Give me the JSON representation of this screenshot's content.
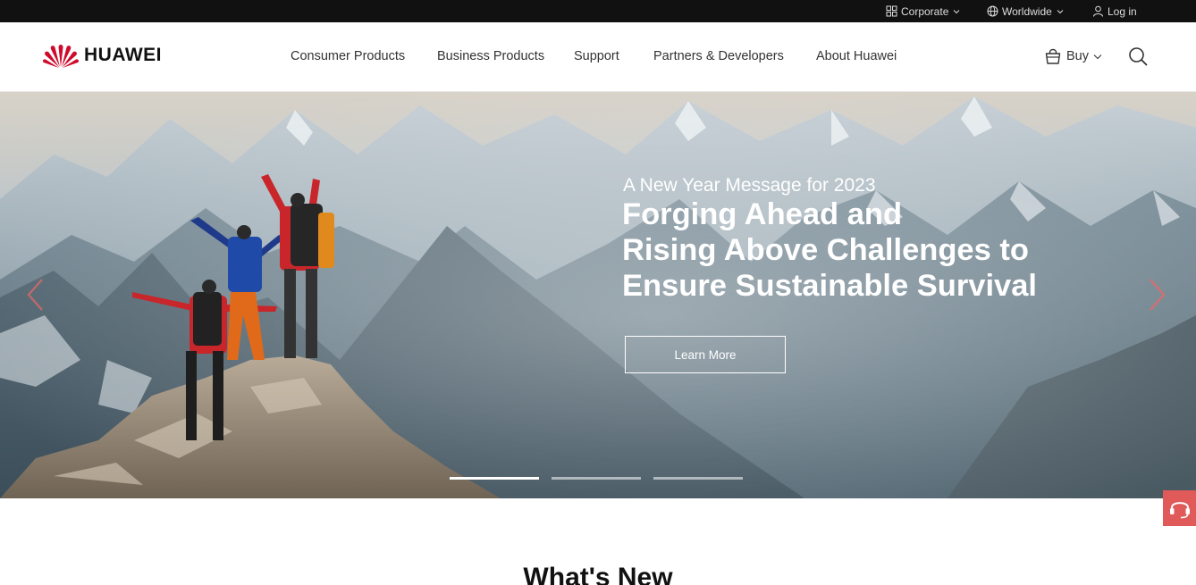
{
  "topbar": {
    "corporate": "Corporate",
    "worldwide": "Worldwide",
    "login": "Log in"
  },
  "brand": {
    "name": "HUAWEI",
    "logo_color": "#cf0a2c"
  },
  "nav": {
    "items": [
      {
        "label": "Consumer Products"
      },
      {
        "label": "Business Products"
      },
      {
        "label": "Support"
      },
      {
        "label": "Partners & Developers"
      },
      {
        "label": "About Huawei"
      }
    ],
    "buy_label": "Buy"
  },
  "hero": {
    "kicker": "A New Year Message for 2023",
    "title_lines": [
      "Forging Ahead and",
      "Rising Above Challenges to",
      "Ensure Sustainable Survival"
    ],
    "cta": "Learn More",
    "slide_count": 3,
    "active_slide": 1
  },
  "section": {
    "heading": "What's New"
  },
  "colors": {
    "topbar_bg": "#111111",
    "accent": "#cf0a2c",
    "support_fab": "#e05a5a"
  }
}
